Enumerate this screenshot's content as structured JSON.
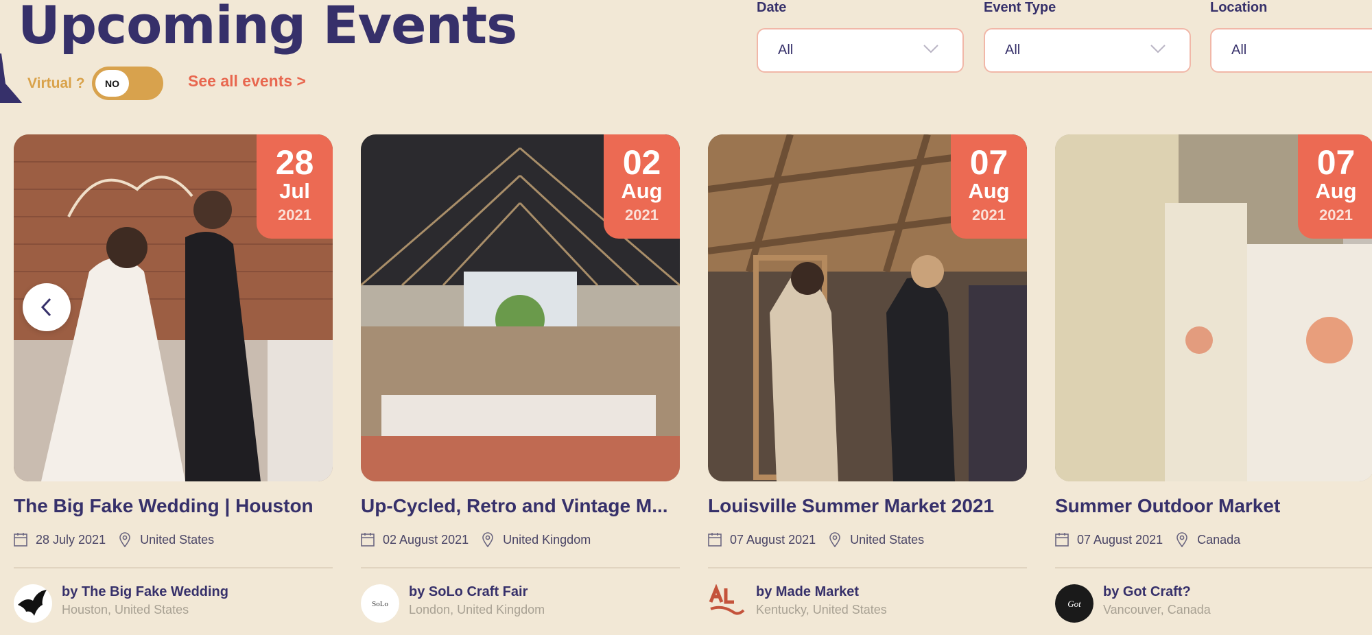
{
  "header": {
    "title": "Upcoming Events",
    "virtual_label": "Virtual ?",
    "virtual_toggle": "NO",
    "see_all": "See all events >"
  },
  "filters": [
    {
      "label": "Date",
      "value": "All"
    },
    {
      "label": "Event Type",
      "value": "All"
    },
    {
      "label": "Location",
      "value": "All"
    }
  ],
  "colors": {
    "background": "#f2e8d6",
    "primary": "#36306a",
    "accent": "#ec6a53",
    "toggle": "#d8a24d"
  },
  "events": [
    {
      "badge": {
        "day": "28",
        "month": "Jul",
        "year": "2021"
      },
      "title": "The Big Fake Wedding | Houston",
      "date": "28 July 2021",
      "country": "United States",
      "organizer": "by The Big Fake Wedding",
      "organizer_location": "Houston, United States"
    },
    {
      "badge": {
        "day": "02",
        "month": "Aug",
        "year": "2021"
      },
      "title": "Up-Cycled, Retro and Vintage M...",
      "date": "02 August 2021",
      "country": "United Kingdom",
      "organizer": "by SoLo Craft Fair",
      "organizer_location": "London, United Kingdom",
      "logo_text": "SoLo CRAFT FAIR"
    },
    {
      "badge": {
        "day": "07",
        "month": "Aug",
        "year": "2021"
      },
      "title": "Louisville Summer Market 2021",
      "date": "07 August 2021",
      "country": "United States",
      "organizer": "by Made Market",
      "organizer_location": "Kentucky, United States"
    },
    {
      "badge": {
        "day": "07",
        "month": "Aug",
        "year": "2021"
      },
      "title": "Summer Outdoor Market",
      "date": "07 August 2021",
      "country": "Canada",
      "organizer": "by Got Craft?",
      "organizer_location": "Vancouver, Canada"
    }
  ],
  "icons": {
    "prev": "chevron-left-icon",
    "calendar": "calendar-icon",
    "location": "map-pin-icon",
    "dropdown": "chevron-down-icon"
  }
}
